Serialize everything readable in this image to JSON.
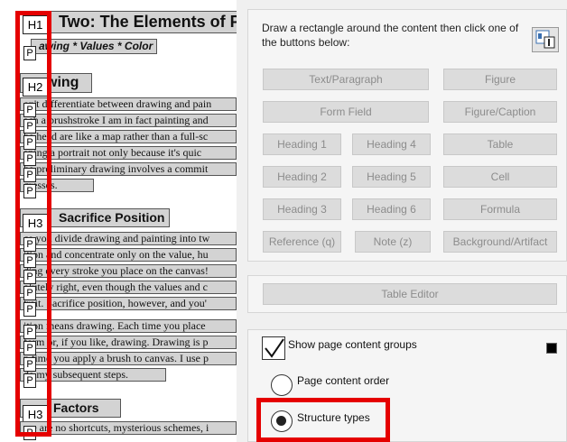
{
  "document": {
    "chapter_title": "Two: The Elements of P",
    "subtitle": "awing * Values * Color",
    "sections": [
      {
        "heading": "wing",
        "tag": "H2"
      },
      {
        "heading": "Sacrifice Position",
        "tag": "H3"
      },
      {
        "heading": "Factors",
        "tag": "H3"
      }
    ],
    "top_tag": "H1",
    "para_tag": "P",
    "lines_group1": [
      "on't differentiate between drawing and pain",
      "ach a brushstroke I am in fact painting and",
      "he head are like a map rather than a full-sc",
      "aping a portrait not only because it's quic",
      "he preliminary drawing involves a commit",
      "gresses."
    ],
    "lines_group2": [
      "ce you divide drawing and painting into tw",
      "ition and concentrate only on the value, hu",
      "ding every stroke you place on the canvas!",
      "olutely right, even though the values and c",
      "trait. Sacrifice position, however, and you'",
      "ition means drawing. Each time you place",
      " form or, if you like, drawing. Drawing is p",
      "n time you apply a brush to canvas. I use p",
      "de my subsequent steps."
    ],
    "lines_group3": [
      "ere are no shortcuts, mysterious schemes, i"
    ]
  },
  "panel": {
    "instruction": "Draw a rectangle around the content then click one of the buttons below:",
    "tag_buttons": [
      {
        "label": "Text/Paragraph"
      },
      {
        "label": "Figure"
      },
      {
        "label": "Form Field"
      },
      {
        "label": "Figure/Caption"
      },
      {
        "label": "Heading 1"
      },
      {
        "label": "Heading 4"
      },
      {
        "label": "Table"
      },
      {
        "label": "Heading 2"
      },
      {
        "label": "Heading 5"
      },
      {
        "label": "Cell"
      },
      {
        "label": "Heading 3"
      },
      {
        "label": "Heading 6"
      },
      {
        "label": "Formula"
      },
      {
        "label": "Reference (q)"
      },
      {
        "label": "Note (z)"
      },
      {
        "label": "Background/Artifact"
      }
    ],
    "table_editor_label": "Table Editor",
    "show_groups_label": "Show page content groups",
    "show_groups_checked": true,
    "radio_options": [
      {
        "label": "Page content order",
        "selected": false
      },
      {
        "label": "Structure types",
        "selected": true
      }
    ],
    "highlight_color": "#e50000",
    "disabled_text_color": "#8c8c8c"
  }
}
